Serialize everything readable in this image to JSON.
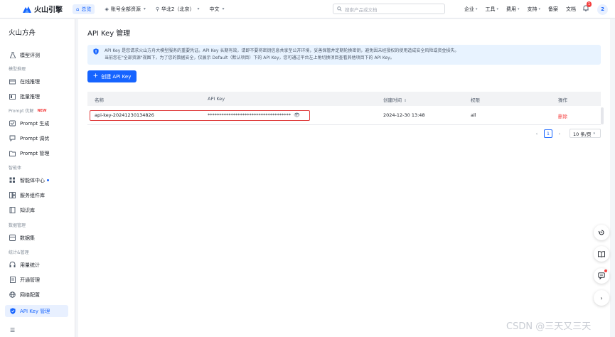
{
  "topbar": {
    "brand": "火山引擎",
    "home": "总览",
    "account_scope": "账号全部资源",
    "region": "华北2（北京）",
    "language": "中文",
    "search_placeholder": "搜索产品或文档",
    "nav": [
      "企业",
      "工具",
      "费用",
      "支持",
      "备案",
      "文档"
    ],
    "notification_count": "1",
    "avatar": "2"
  },
  "sidebar": {
    "product_name": "火山方舟",
    "items": [
      {
        "label": "模型评测",
        "icon": "flask-icon"
      },
      {
        "group": "模型推理"
      },
      {
        "label": "在线推理",
        "icon": "cloud-icon"
      },
      {
        "label": "批量推理",
        "icon": "batch-icon"
      },
      {
        "group": "Prompt 优解",
        "badge": "NEW"
      },
      {
        "label": "Prompt 生成",
        "icon": "wand-icon"
      },
      {
        "label": "Prompt 调优",
        "icon": "tune-icon"
      },
      {
        "label": "Prompt 管理",
        "icon": "folder-icon"
      },
      {
        "group": "智能体"
      },
      {
        "label": "智能体中心",
        "icon": "grid-icon"
      },
      {
        "label": "服务组件库",
        "icon": "component-icon"
      },
      {
        "label": "知识库",
        "icon": "book-icon"
      },
      {
        "group": "数据管理"
      },
      {
        "label": "数据集",
        "icon": "dataset-icon"
      },
      {
        "group": "统计&管理"
      },
      {
        "label": "用量统计",
        "icon": "headset-icon"
      },
      {
        "label": "开通管理",
        "icon": "doc-icon"
      },
      {
        "label": "网络配置",
        "icon": "network-icon"
      },
      {
        "label": "API Key 管理",
        "icon": "shield-icon",
        "active": true
      }
    ]
  },
  "main": {
    "title": "API Key 管理",
    "alert_line1": "API Key 是您请求火山方舟大模型服务的重要凭证。API Key 长期有效，请即不要将密钥信息共享至公开环境，妥善保管并定期轮换密钥，避免因未经授权的使用造成安全风险或资金损失。",
    "alert_line2": "当前您在\"全部资源\"视图下，为了您的数据安全，仅展示 Default（默认项目）下的 API Key，您可通过平台左上角切换项目查看其他项目下的 API Key。",
    "create_button": "创建 API Key",
    "columns": {
      "name": "名称",
      "key": "API Key",
      "created": "创建时间",
      "permission": "权限",
      "actions": "操作"
    },
    "rows": [
      {
        "name": "api-key-20241230134826",
        "key": "************************************",
        "created": "2024-12-30 13:48",
        "permission": "all",
        "action": "删除"
      }
    ],
    "pagination": {
      "current_page": "1",
      "page_size": "10 条/页"
    }
  },
  "watermark": "CSDN @三天又三天"
}
